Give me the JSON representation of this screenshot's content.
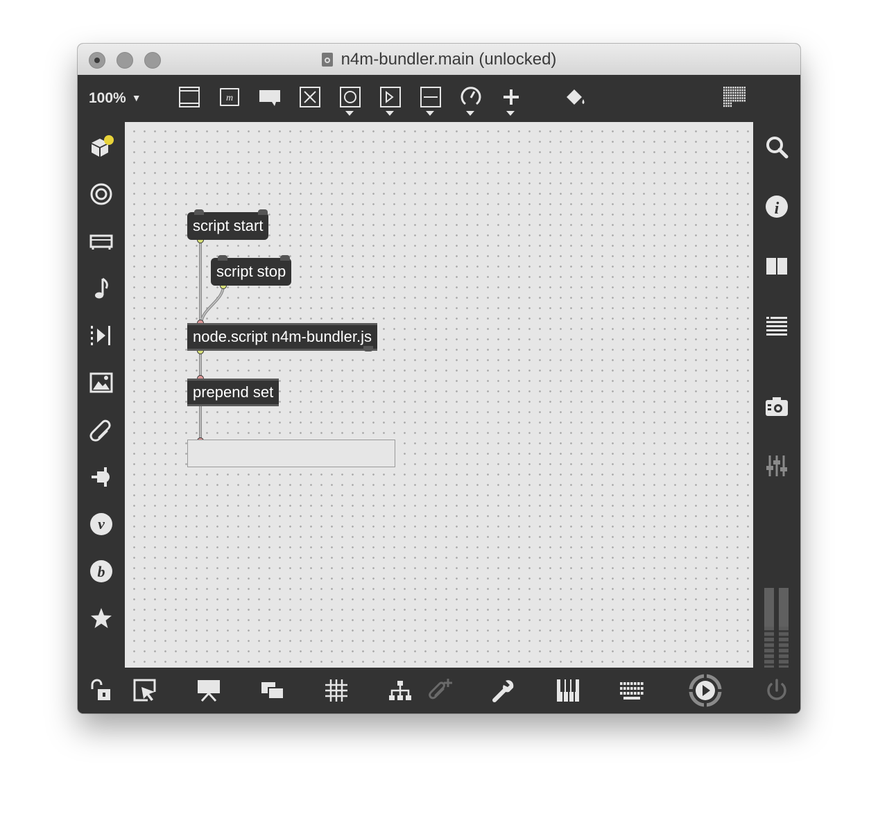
{
  "window": {
    "title": "n4m-bundler.main (unlocked)"
  },
  "toolbar": {
    "zoom": "100%",
    "icons": [
      "presentation-panel-icon",
      "message-icon",
      "comment-icon",
      "toggle-icon",
      "button-icon",
      "playbar-icon",
      "slider-icon",
      "dial-icon",
      "add-icon",
      "paint-bucket-icon",
      "grid-matrix-icon"
    ]
  },
  "left_sidebar": {
    "icons": [
      "package-manager-icon",
      "target-icon",
      "mixer-icon",
      "music-note-icon",
      "step-forward-icon",
      "image-icon",
      "paperclip-icon",
      "plug-icon",
      "vizzie-icon",
      "bpatcher-icon",
      "favorites-star-icon"
    ]
  },
  "right_sidebar": {
    "icons": [
      "search-icon",
      "info-icon",
      "book-icon",
      "list-icon",
      "snapshot-camera-icon",
      "mixer-sliders-icon"
    ]
  },
  "patch": {
    "objects": [
      {
        "id": "script-start",
        "text": "script start",
        "kind": "message"
      },
      {
        "id": "script-stop",
        "text": "script stop",
        "kind": "message"
      },
      {
        "id": "node-script",
        "text": "node.script n4m-bundler.js",
        "kind": "object"
      },
      {
        "id": "prepend-set",
        "text": "prepend set",
        "kind": "object"
      },
      {
        "id": "output-message",
        "text": "",
        "kind": "message"
      }
    ]
  },
  "bottom_toolbar": {
    "icons": [
      "lock-icon",
      "select-arrow-icon",
      "presentation-icon",
      "window-icon",
      "grid-icon",
      "hierarchy-icon",
      "attach-icon",
      "wrench-icon",
      "piano-keys-icon",
      "keyboard-icon",
      "play-circle-icon",
      "power-icon"
    ]
  },
  "colors": {
    "chrome": "#333333",
    "canvas": "#e6e6e6",
    "notification_dot": "#e8d33a",
    "outlet_yellow": "#d8e07a",
    "inlet_red": "#d99"
  }
}
